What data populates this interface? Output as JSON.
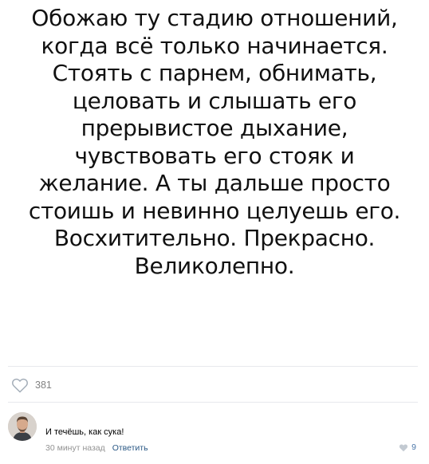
{
  "post": {
    "text_lines": [
      "Обожаю ту стадию отношений,",
      "когда всё только начинается.",
      "Стоять с парнем, обнимать,",
      "целовать и слышать его",
      "прерывистое дыхание,",
      "чувствовать его стояк и",
      "желание. А ты дальше просто",
      "стоишь и невинно целуешь его.",
      "Восхитительно. Прекрасно.",
      "Великолепно."
    ],
    "likes_count": "381",
    "like_icon": "heart-outline-icon"
  },
  "comment": {
    "text": "И течёшь, как сука!",
    "time": "30 минут назад",
    "reply_label": "Ответить",
    "likes_count": "9",
    "like_icon": "heart-icon"
  },
  "colors": {
    "divider": "#e7e8ec",
    "meta_text": "#939393",
    "link": "#2a5885",
    "like_count": "#4a76a8"
  }
}
